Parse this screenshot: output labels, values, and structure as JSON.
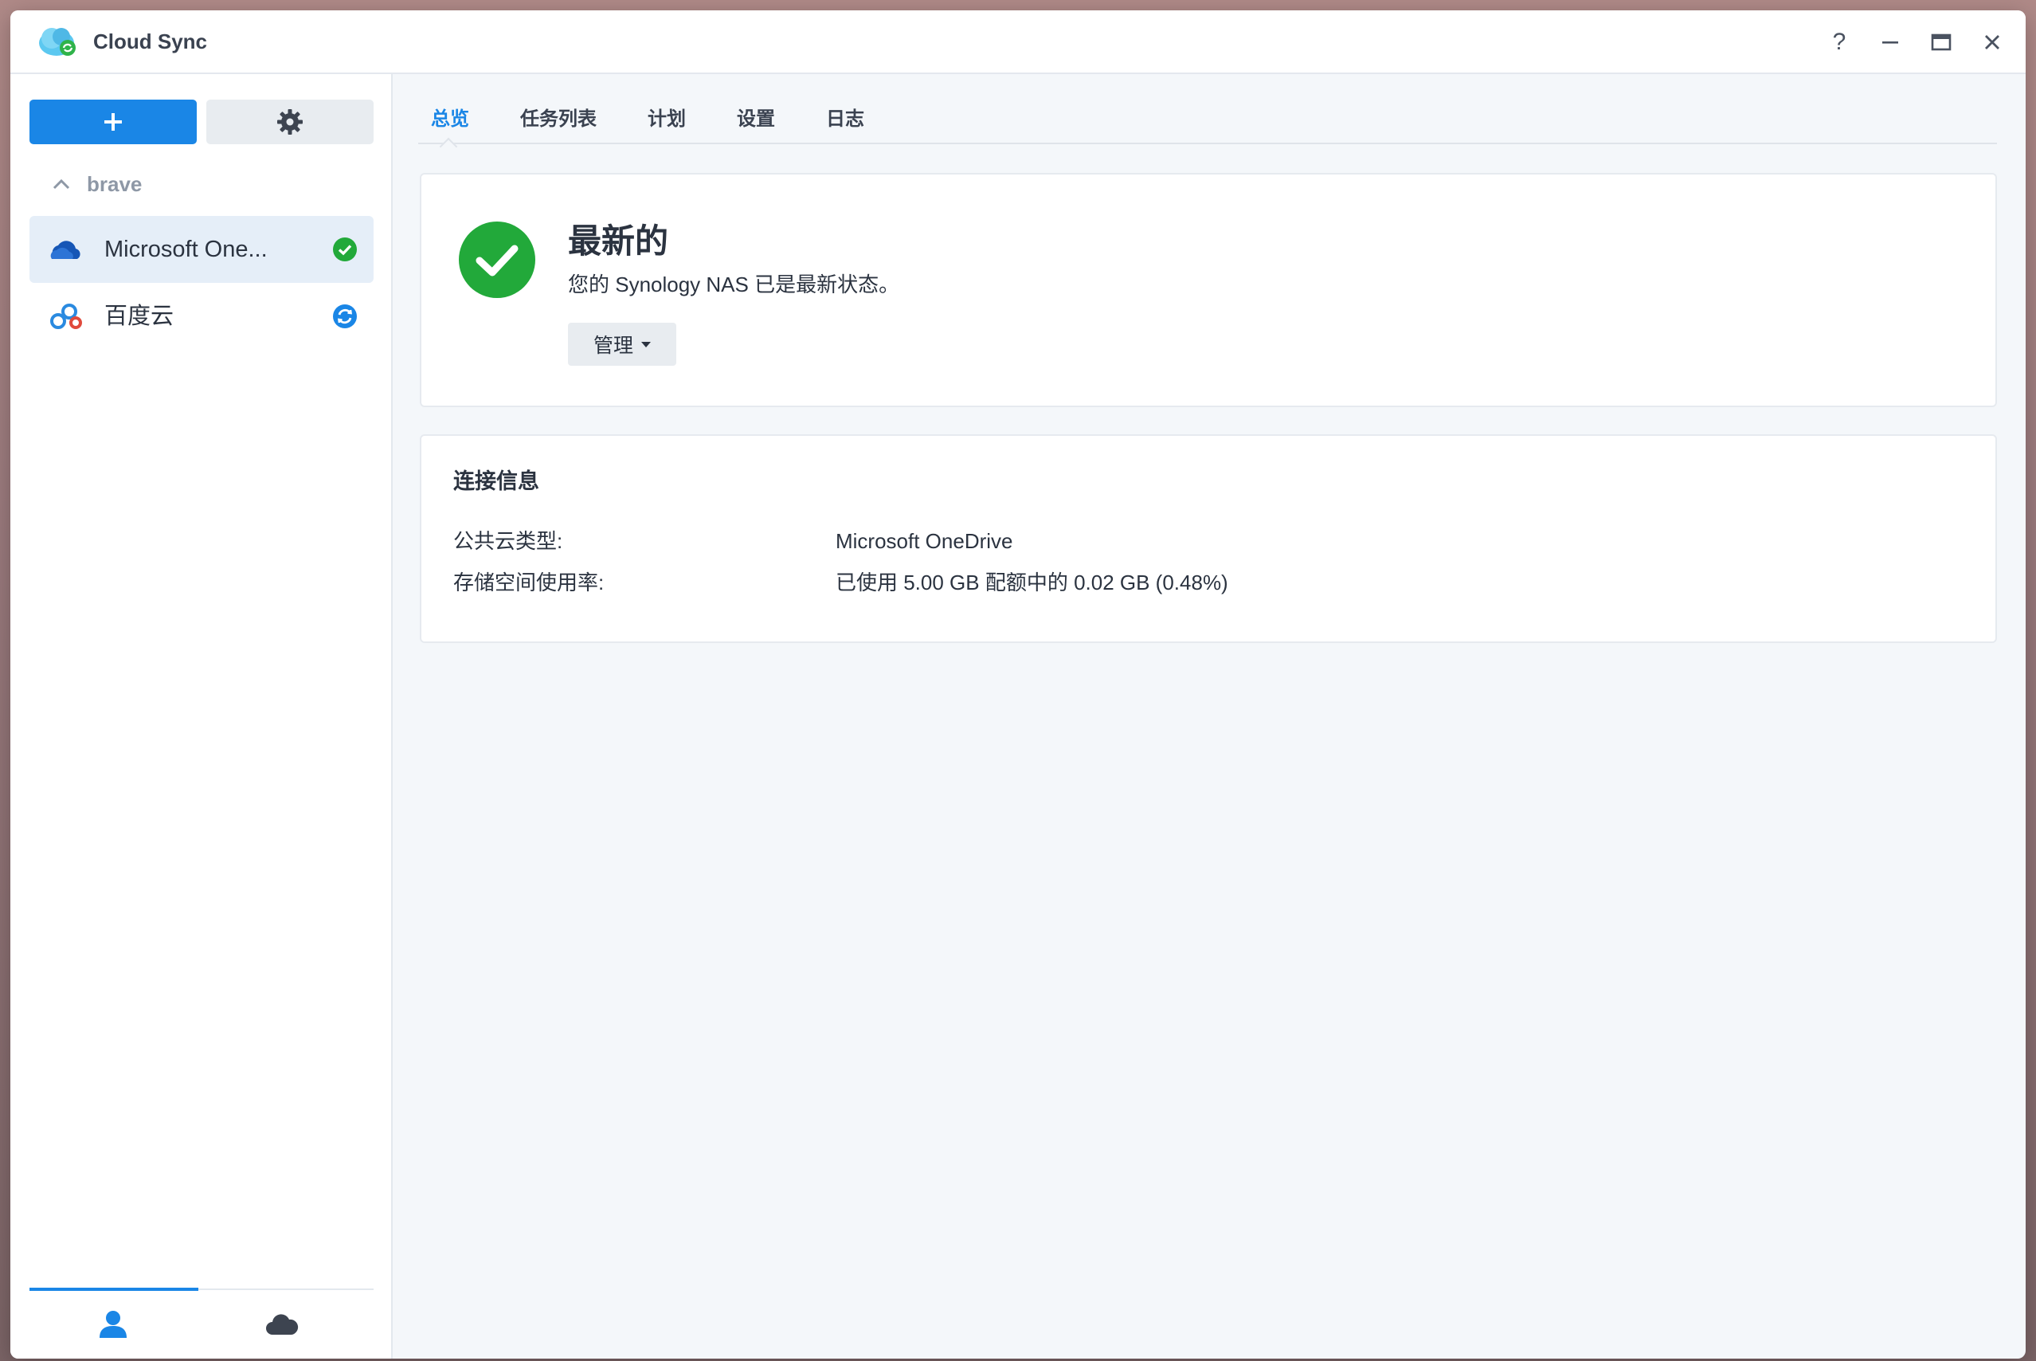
{
  "app": {
    "title": "Cloud Sync",
    "window_buttons": [
      {
        "name": "help",
        "glyph": "?"
      },
      {
        "name": "minimize",
        "glyph": "—"
      },
      {
        "name": "maximize",
        "glyph": "▭"
      },
      {
        "name": "close",
        "glyph": "✕"
      }
    ]
  },
  "sidebar": {
    "add_icon": "plus-icon",
    "settings_icon": "gear-icon",
    "group": {
      "label": "brave",
      "expanded": true
    },
    "tasks": [
      {
        "name": "Microsoft One...",
        "icon": "onedrive-icon",
        "status": "ok-status-icon",
        "status_color": "#22a93a",
        "selected": true
      },
      {
        "name": "百度云",
        "icon": "baidu-cloud-icon",
        "status": "syncing-status-icon",
        "status_color": "#1a86e6",
        "selected": false
      }
    ],
    "bottom_tabs": [
      {
        "icon": "user-icon",
        "active": true
      },
      {
        "icon": "cloud-icon",
        "active": false
      }
    ]
  },
  "main": {
    "tabs": [
      {
        "label": "总览",
        "active": true
      },
      {
        "label": "任务列表",
        "active": false
      },
      {
        "label": "计划",
        "active": false
      },
      {
        "label": "设置",
        "active": false
      },
      {
        "label": "日志",
        "active": false
      }
    ],
    "status": {
      "title": "最新的",
      "description": "您的 Synology NAS 已是最新状态。",
      "manage_label": "管理"
    },
    "connection": {
      "title": "连接信息",
      "rows": [
        {
          "key": "公共云类型:",
          "value": "Microsoft OneDrive"
        },
        {
          "key": "存储空间使用率:",
          "value": "已使用 5.00 GB 配额中的 0.02 GB (0.48%)"
        }
      ]
    }
  },
  "colors": {
    "accent": "#1a86e6",
    "success": "#22a93a"
  }
}
